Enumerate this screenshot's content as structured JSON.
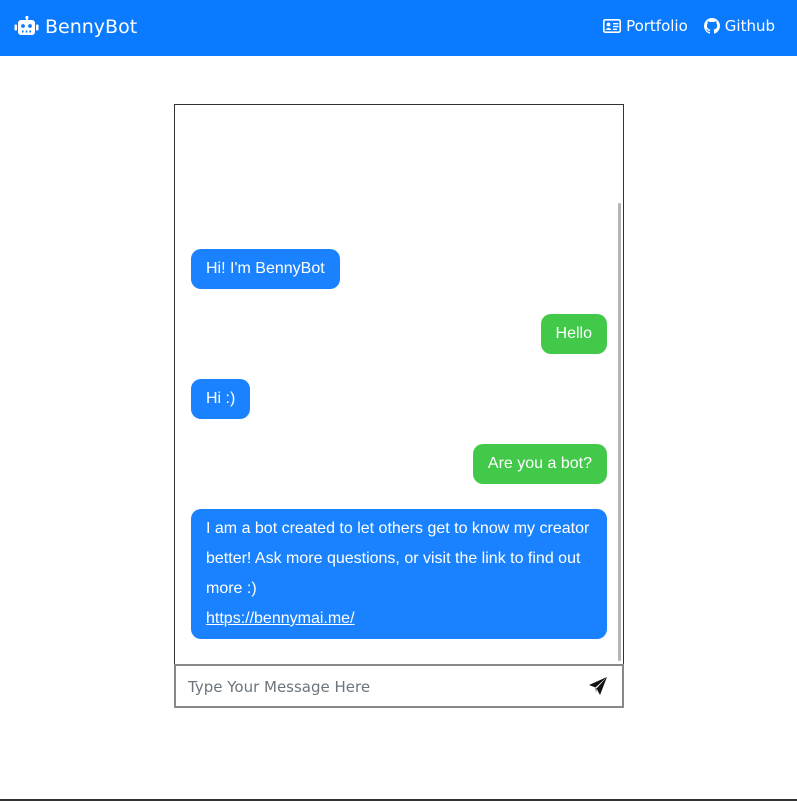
{
  "navbar": {
    "brand_label": "BennyBot",
    "links": [
      {
        "label": "Portfolio",
        "icon": "id-card-icon"
      },
      {
        "label": "Github",
        "icon": "github-icon"
      }
    ],
    "background_color": "#0a7bff"
  },
  "chat": {
    "messages": [
      {
        "sender": "bot",
        "text": "Hi! I'm BennyBot"
      },
      {
        "sender": "user",
        "text": "Hello"
      },
      {
        "sender": "bot",
        "text": "Hi :)"
      },
      {
        "sender": "user",
        "text": "Are you a bot?"
      },
      {
        "sender": "bot",
        "lines": [
          "I am a bot created to let others get to know my creator",
          "better! Ask more questions, or visit the link to find out",
          "more :)"
        ],
        "link": "https://bennymai.me/"
      }
    ],
    "bot_bubble_color": "#1a82ff",
    "user_bubble_color": "#42c94a"
  },
  "composer": {
    "placeholder": "Type Your Message Here",
    "value": "",
    "send_icon": "paper-plane-icon"
  }
}
